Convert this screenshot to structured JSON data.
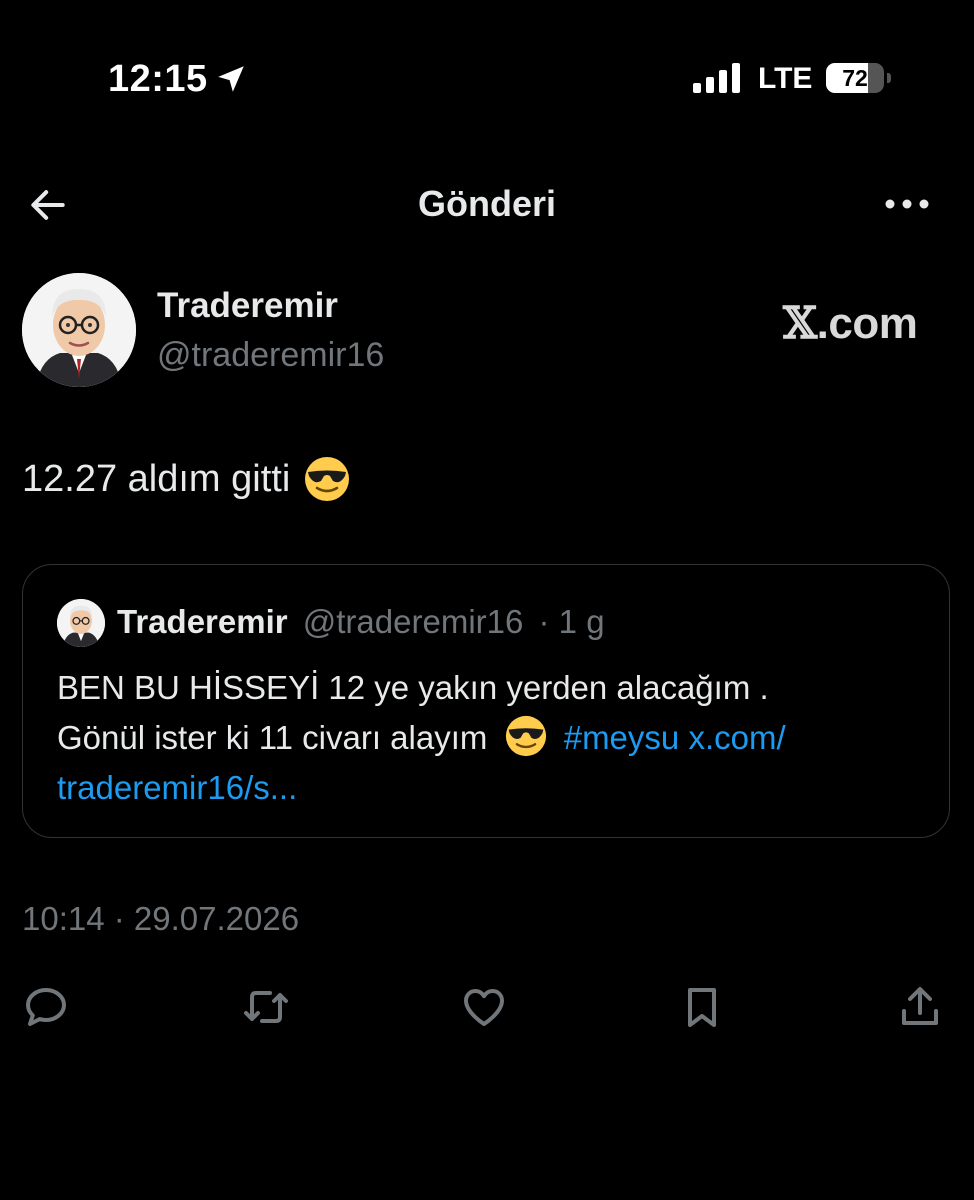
{
  "status_bar": {
    "time": "12:15",
    "network": "LTE",
    "battery_level": "72"
  },
  "nav": {
    "title": "Gönderi"
  },
  "author": {
    "name": "Traderemir",
    "handle": "@traderemir16"
  },
  "brand": {
    "x_glyph": "𝕏",
    "domain_suffix": ".com"
  },
  "tweet": {
    "text": "12.27 aldım gitti",
    "timestamp": "10:14 · 29.07.2026"
  },
  "quote": {
    "name": "Traderemir",
    "handle": "@traderemir16",
    "age": "· 1 g",
    "text_line1": "BEN BU HİSSEYİ 12 ye yakın yerden alacağım .",
    "text_line2": "Gönül ister ki 11 civarı alayım",
    "hashtag": "#meysu",
    "link_start": "x.com/",
    "link_end": "traderemir16/s..."
  },
  "colors": {
    "background": "#000000",
    "text": "#e7e9ea",
    "secondary": "#71767b",
    "link": "#1d9bf0",
    "border": "#2f3336"
  },
  "actions": {
    "icons": [
      "reply-icon",
      "retweet-icon",
      "like-icon",
      "bookmark-icon",
      "share-icon"
    ]
  }
}
